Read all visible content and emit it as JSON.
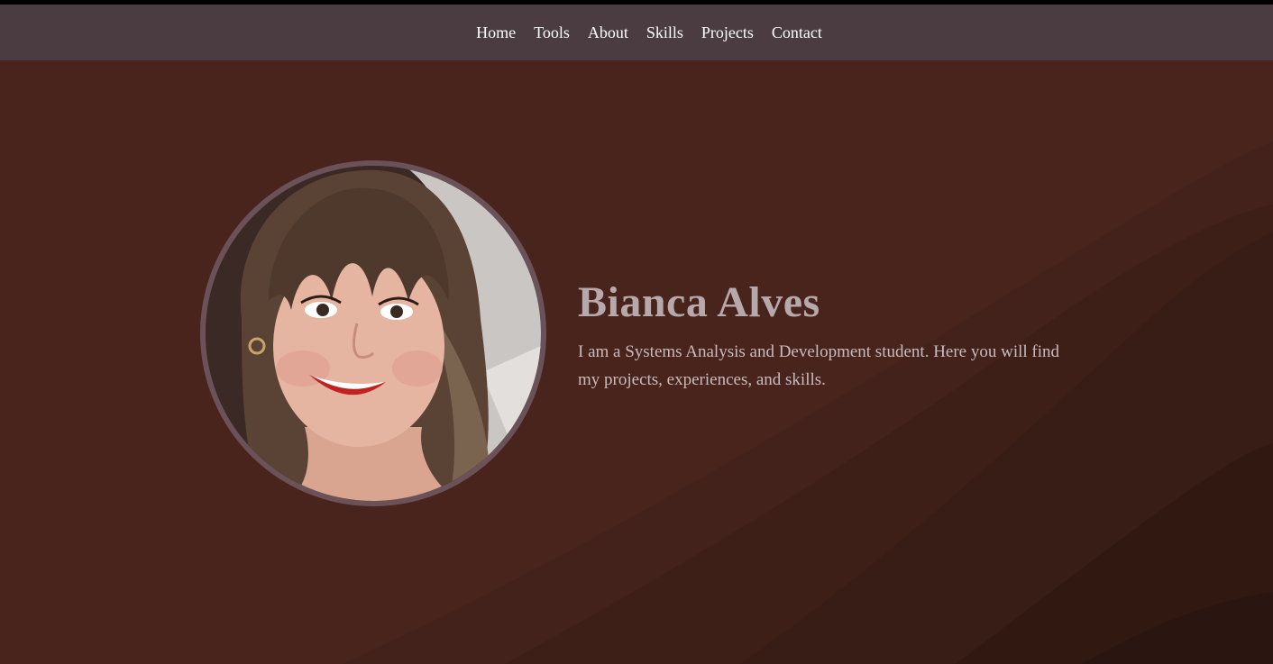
{
  "nav": {
    "items": [
      {
        "label": "Home"
      },
      {
        "label": "Tools"
      },
      {
        "label": "About"
      },
      {
        "label": "Skills"
      },
      {
        "label": "Projects"
      },
      {
        "label": "Contact"
      }
    ]
  },
  "hero": {
    "name": "Bianca Alves",
    "description": "I am a Systems Analysis and Development student. Here you will find my projects, experiences, and skills."
  },
  "colors": {
    "navbar": "#4a3c41",
    "background": "#47241c",
    "name_text": "#b6a8ab",
    "avatar_border": "#6a5258"
  }
}
